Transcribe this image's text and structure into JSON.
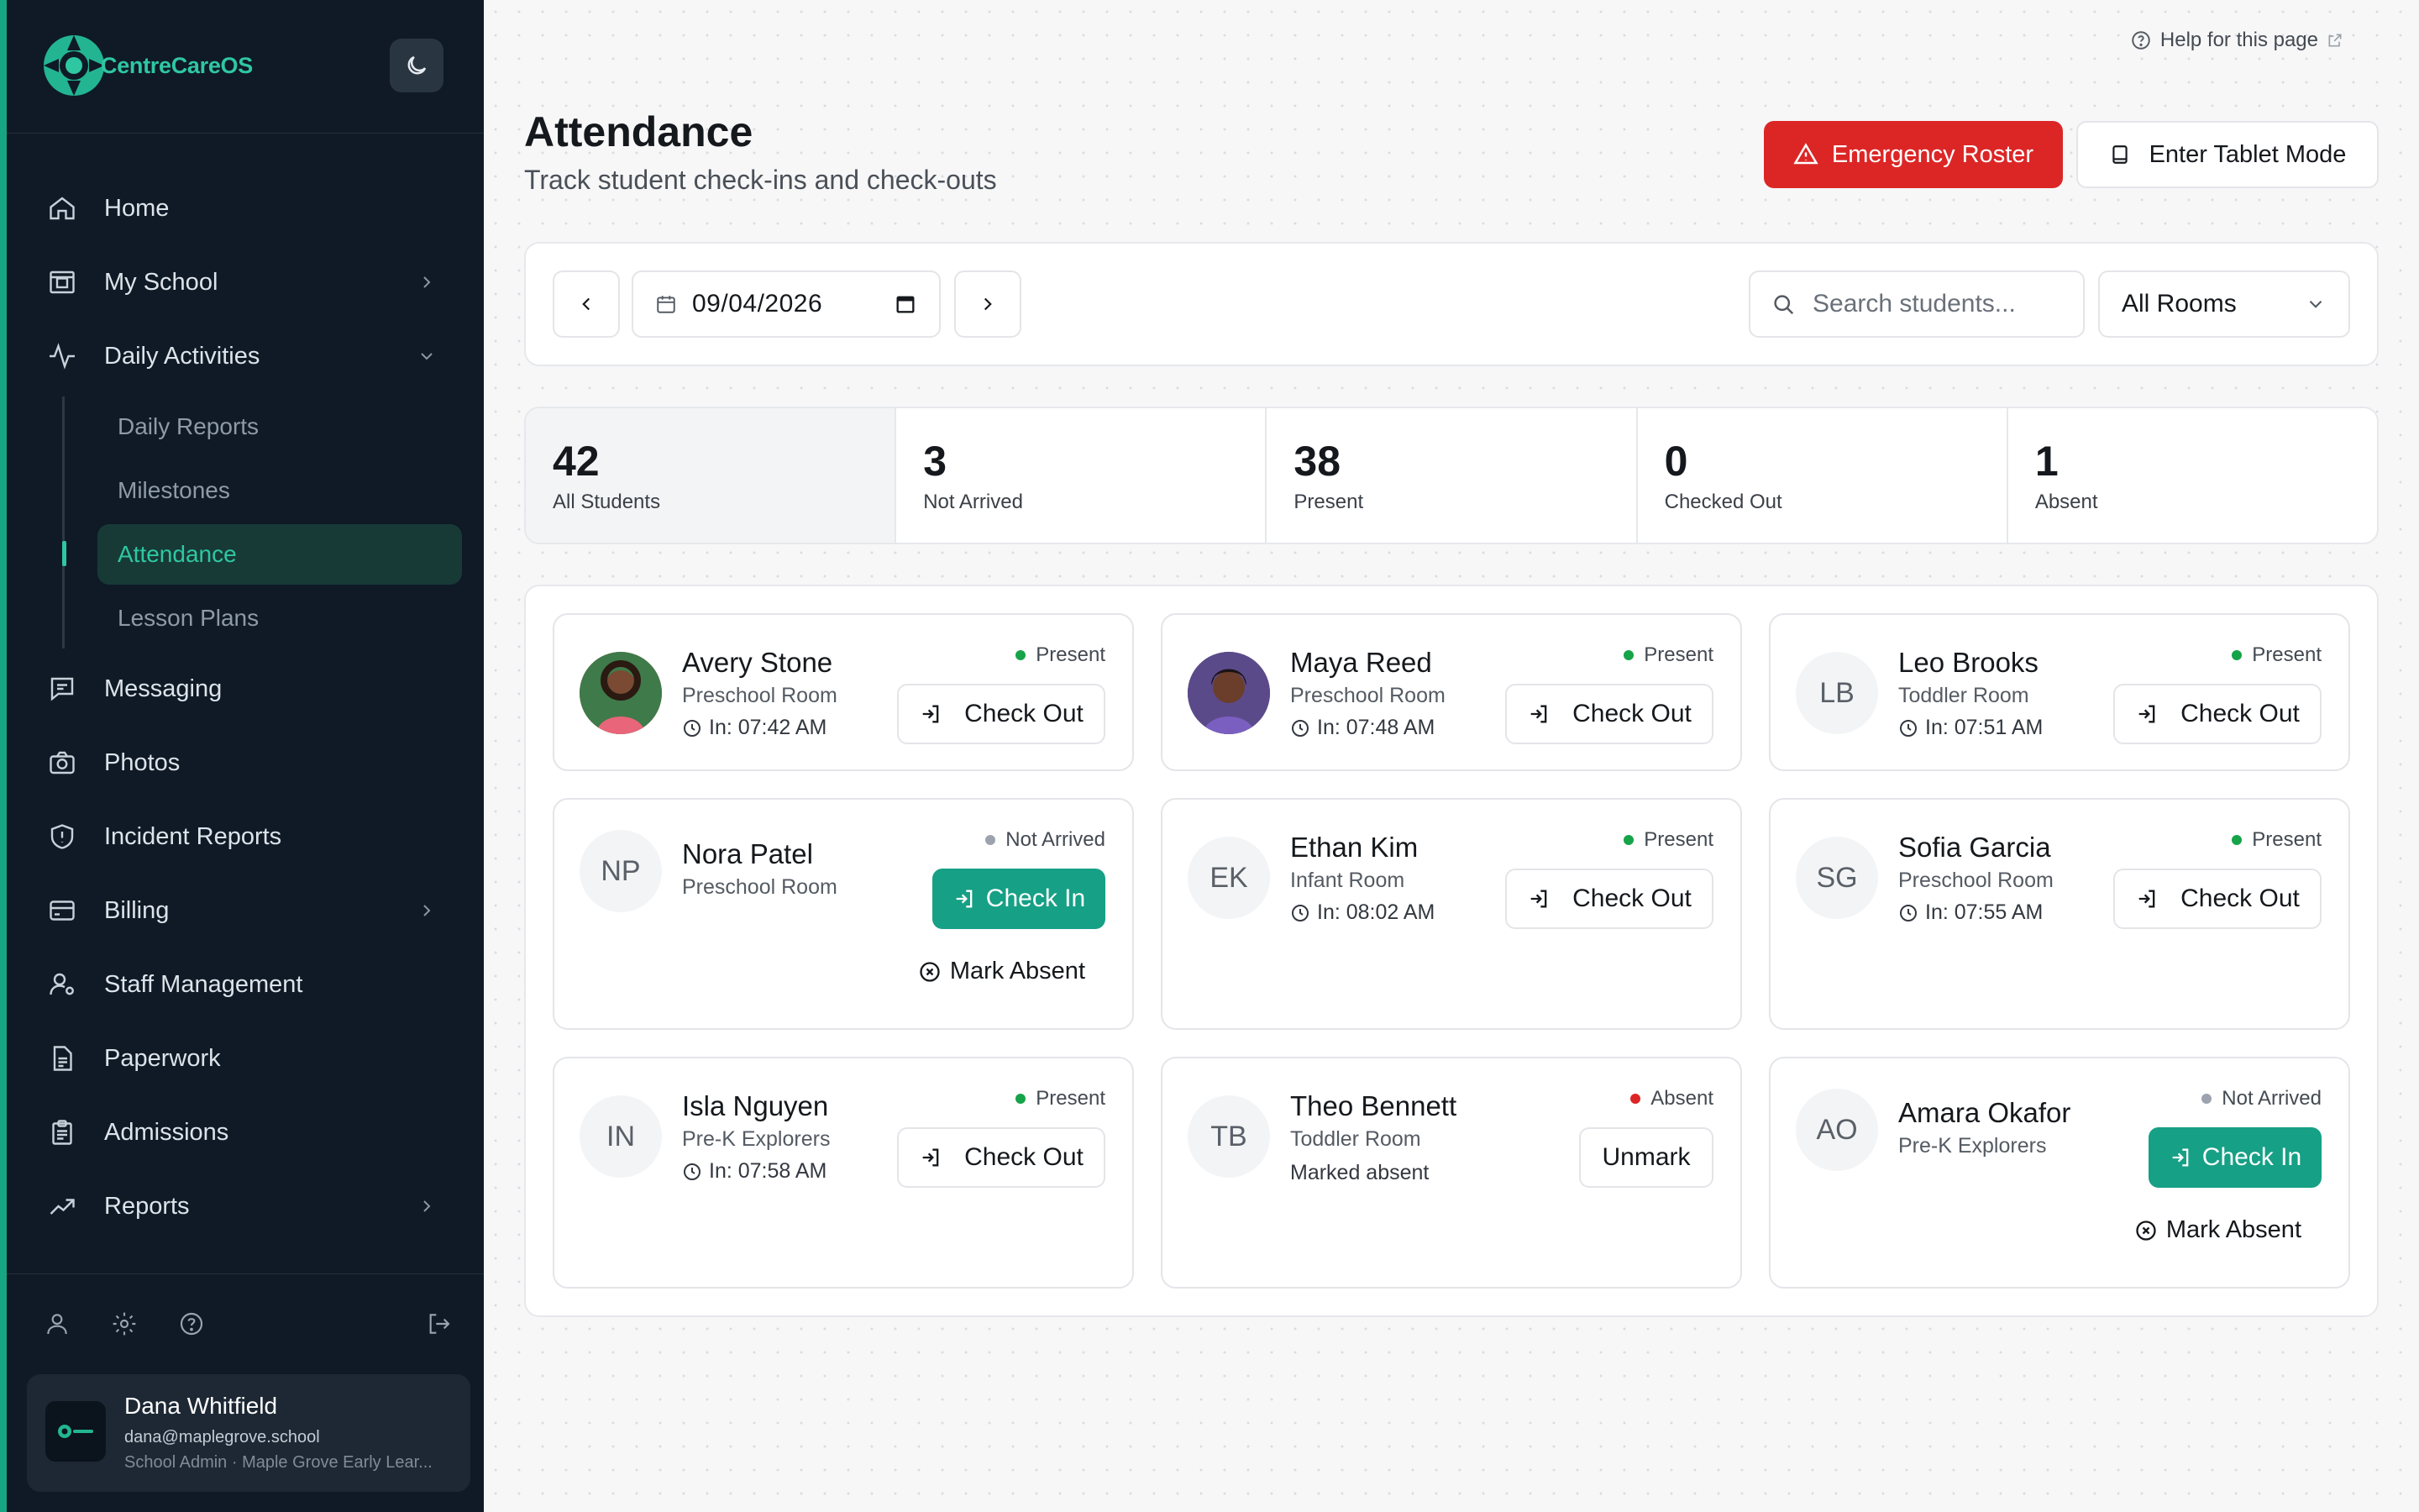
{
  "app": {
    "name": "CentreCareOS"
  },
  "sidebar": {
    "nav": [
      {
        "label": "Home",
        "icon": "home-icon"
      },
      {
        "label": "My School",
        "icon": "school-icon"
      },
      {
        "label": "Daily Activities",
        "icon": "activity-icon"
      },
      {
        "label": "Messaging",
        "icon": "message-icon"
      },
      {
        "label": "Photos",
        "icon": "camera-icon"
      },
      {
        "label": "Incident Reports",
        "icon": "shield-icon"
      },
      {
        "label": "Billing",
        "icon": "billing-icon"
      },
      {
        "label": "Staff Management",
        "icon": "staff-icon"
      },
      {
        "label": "Paperwork",
        "icon": "document-icon"
      },
      {
        "label": "Admissions",
        "icon": "clipboard-icon"
      },
      {
        "label": "Reports",
        "icon": "trend-icon"
      }
    ],
    "sub": [
      {
        "label": "Daily Reports"
      },
      {
        "label": "Milestones"
      },
      {
        "label": "Attendance"
      },
      {
        "label": "Lesson Plans"
      }
    ],
    "user": {
      "name": "Dana Whitfield",
      "email": "dana@maplegrove.school",
      "role": "School Admin · Maple Grove Early Lear..."
    }
  },
  "header": {
    "help": "Help for this page",
    "title": "Attendance",
    "subtitle": "Track student check-ins and check-outs",
    "emergency": "Emergency Roster",
    "tablet": "Enter Tablet Mode"
  },
  "toolbar": {
    "date": "09/04/2026",
    "search_placeholder": "Search students...",
    "room": "All Rooms"
  },
  "stats": [
    {
      "value": "42",
      "label": "All Students"
    },
    {
      "value": "3",
      "label": "Not Arrived"
    },
    {
      "value": "38",
      "label": "Present"
    },
    {
      "value": "0",
      "label": "Checked Out"
    },
    {
      "value": "1",
      "label": "Absent"
    }
  ],
  "students": [
    {
      "name": "Avery Stone",
      "room": "Preschool Room",
      "time": "In: 07:42 AM",
      "status": "Present",
      "action": "Check Out"
    },
    {
      "name": "Maya Reed",
      "room": "Preschool Room",
      "time": "In: 07:48 AM",
      "status": "Present",
      "action": "Check Out"
    },
    {
      "name": "Leo Brooks",
      "initials": "LB",
      "room": "Toddler Room",
      "time": "In: 07:51 AM",
      "status": "Present",
      "action": "Check Out"
    },
    {
      "name": "Nora Patel",
      "initials": "NP",
      "room": "Preschool Room",
      "status": "Not Arrived",
      "action": "Check In",
      "secondary": "Mark Absent"
    },
    {
      "name": "Ethan Kim",
      "initials": "EK",
      "room": "Infant Room",
      "time": "In: 08:02 AM",
      "status": "Present",
      "action": "Check Out"
    },
    {
      "name": "Sofia Garcia",
      "initials": "SG",
      "room": "Preschool Room",
      "time": "In: 07:55 AM",
      "status": "Present",
      "action": "Check Out"
    },
    {
      "name": "Isla Nguyen",
      "initials": "IN",
      "room": "Pre-K Explorers",
      "time": "In: 07:58 AM",
      "status": "Present",
      "action": "Check Out"
    },
    {
      "name": "Theo Bennett",
      "initials": "TB",
      "room": "Toddler Room",
      "note": "Marked absent",
      "status": "Absent",
      "action": "Unmark"
    },
    {
      "name": "Amara Okafor",
      "initials": "AO",
      "room": "Pre-K Explorers",
      "status": "Not Arrived",
      "action": "Check In",
      "secondary": "Mark Absent"
    }
  ],
  "colors": {
    "accent": "#16a085",
    "present": "#16a34a",
    "absent": "#dc2626",
    "not_arrived": "#9ca3af",
    "emergency": "#dc2626",
    "sidebar": "#0f1a26"
  }
}
